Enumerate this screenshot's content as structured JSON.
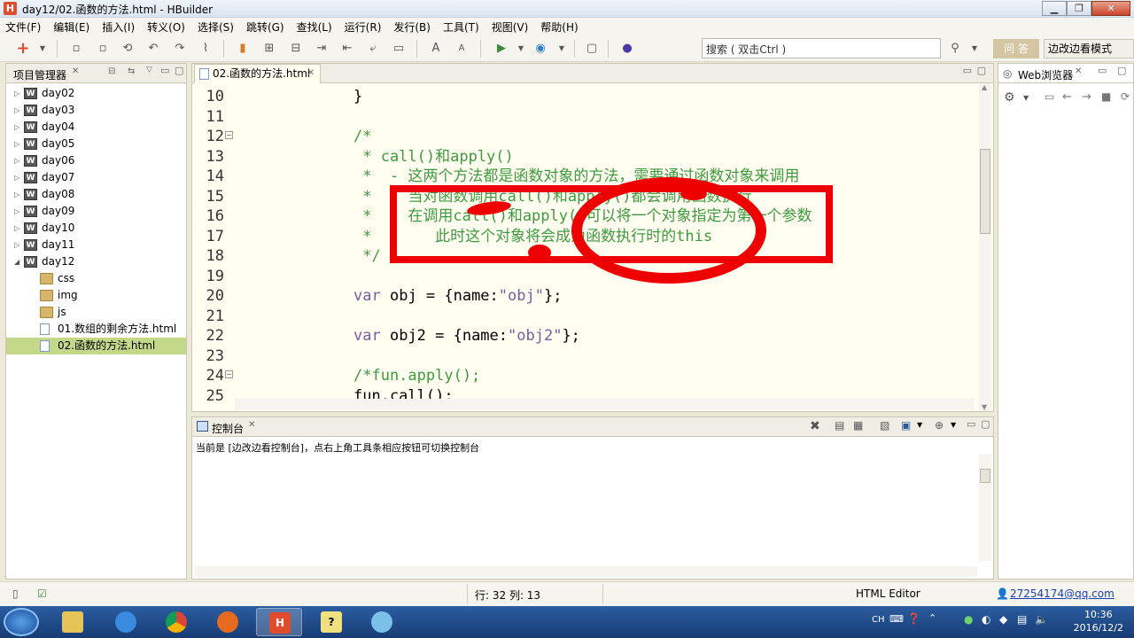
{
  "window": {
    "title": "day12/02.函数的方法.html  -  HBuilder",
    "app_icon": "H"
  },
  "menu": [
    "文件(F)",
    "编辑(E)",
    "插入(I)",
    "转义(O)",
    "选择(S)",
    "跳转(G)",
    "查找(L)",
    "运行(R)",
    "发行(B)",
    "工具(T)",
    "视图(V)",
    "帮助(H)"
  ],
  "toolbar": {
    "search_placeholder": "搜索 ( 双击Ctrl )",
    "ask_label": "问 答",
    "mode_label": "边改边看模式"
  },
  "project": {
    "title": "项目管理器",
    "items": [
      {
        "label": "day02",
        "type": "project",
        "expanded": false
      },
      {
        "label": "day03",
        "type": "project",
        "expanded": false
      },
      {
        "label": "day04",
        "type": "project",
        "expanded": false
      },
      {
        "label": "day05",
        "type": "project",
        "expanded": false
      },
      {
        "label": "day06",
        "type": "project",
        "expanded": false
      },
      {
        "label": "day07",
        "type": "project",
        "expanded": false
      },
      {
        "label": "day08",
        "type": "project",
        "expanded": false
      },
      {
        "label": "day09",
        "type": "project",
        "expanded": false
      },
      {
        "label": "day10",
        "type": "project",
        "expanded": false
      },
      {
        "label": "day11",
        "type": "project",
        "expanded": false
      },
      {
        "label": "day12",
        "type": "project",
        "expanded": true
      },
      {
        "label": "css",
        "type": "folder"
      },
      {
        "label": "img",
        "type": "folder"
      },
      {
        "label": "js",
        "type": "folder"
      },
      {
        "label": "01.数组的剩余方法.html",
        "type": "file"
      },
      {
        "label": "02.函数的方法.html",
        "type": "file",
        "selected": true
      }
    ]
  },
  "editor": {
    "tab_label": "02.函数的方法.html",
    "lines": [
      {
        "n": "10",
        "text": "}"
      },
      {
        "n": "11",
        "text": ""
      },
      {
        "n": "12",
        "text": "/*"
      },
      {
        "n": "13",
        "text": " * call()和apply()"
      },
      {
        "n": "14",
        "text": " *  - 这两个方法都是函数对象的方法，需要通过函数对象来调用"
      },
      {
        "n": "15",
        "text": " *    当对函数调用call()和apply()都会调用函数执行"
      },
      {
        "n": "16",
        "text": " *    在调用call()和apply()可以将一个对象指定为第一个参数"
      },
      {
        "n": "17",
        "text": " *       此时这个对象将会成为函数执行时的this"
      },
      {
        "n": "18",
        "text": " */"
      },
      {
        "n": "19",
        "text": ""
      },
      {
        "n": "20",
        "text": "var obj = {name:\"obj\"};"
      },
      {
        "n": "21",
        "text": ""
      },
      {
        "n": "22",
        "text": "var obj2 = {name:\"obj2\"};"
      },
      {
        "n": "23",
        "text": ""
      },
      {
        "n": "24",
        "text": "/*fun.apply();"
      },
      {
        "n": "25",
        "text": "fun.call();"
      }
    ]
  },
  "console": {
    "title": "控制台",
    "info": "当前是 [边改边看控制台]，点右上角工具条相应按钮可切换控制台"
  },
  "browser": {
    "title": "Web浏览器"
  },
  "status": {
    "position": "行: 32 列: 13",
    "editor_type": "HTML Editor",
    "user": "27254174@qq.com"
  },
  "taskbar": {
    "lang": "CH",
    "time": "10:36",
    "date": "2016/12/2"
  },
  "colors": {
    "annotation": "#ee0000",
    "selection": "#c4d88a",
    "comment": "#3f9a3f",
    "keyword": "#7a5c9e"
  }
}
